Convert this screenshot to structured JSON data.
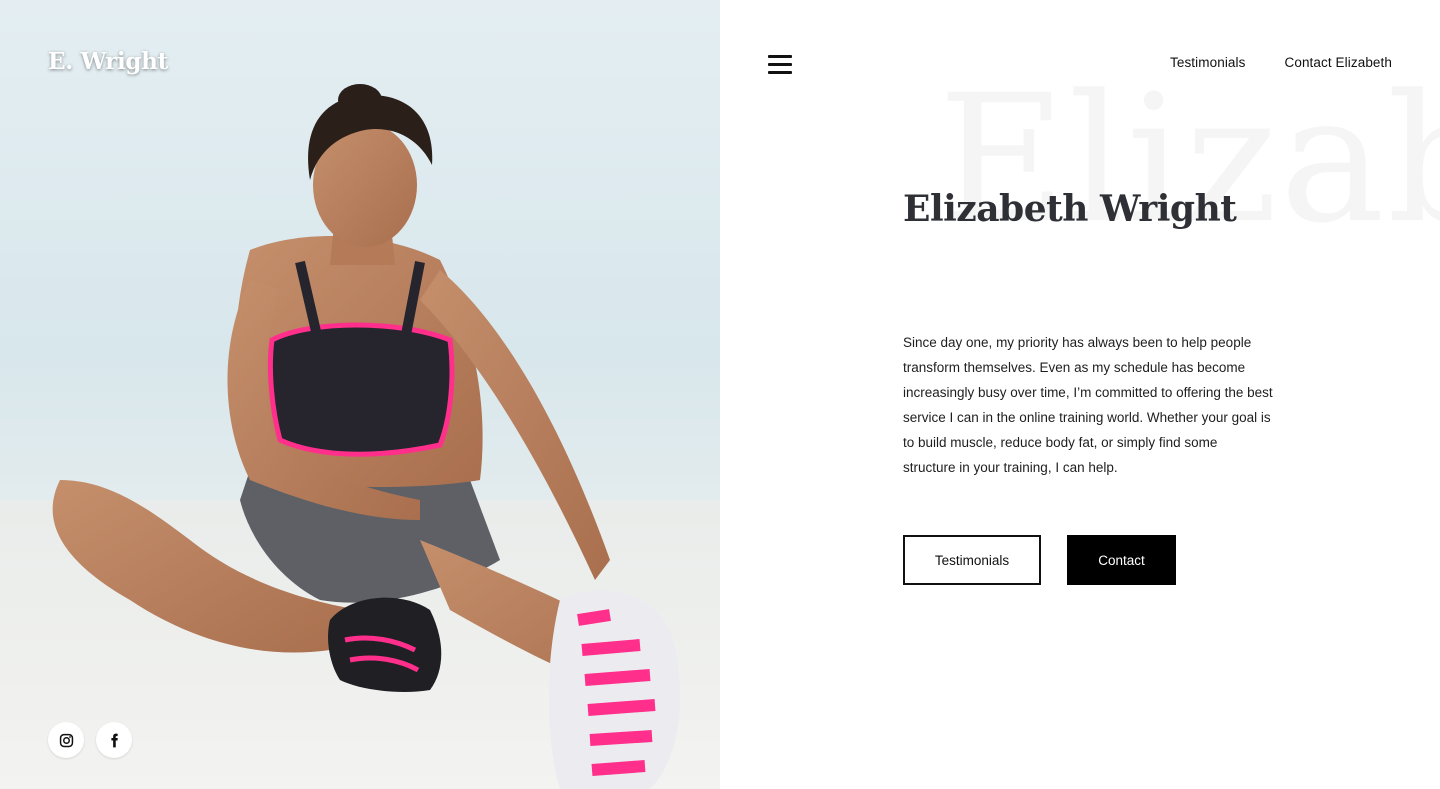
{
  "brand": {
    "logo_text": "E. Wright"
  },
  "hero": {
    "photo": "athlete-stretching-photo"
  },
  "social": {
    "items": [
      {
        "icon": "instagram-icon",
        "label": "Instagram"
      },
      {
        "icon": "facebook-icon",
        "label": "Facebook"
      }
    ]
  },
  "nav": {
    "menu_icon": "hamburger-menu-icon",
    "links": [
      "Testimonials",
      "Contact Elizabeth"
    ]
  },
  "main": {
    "background_word": "Elizabeth",
    "title": "Elizabeth Wright",
    "bio": "Since day one, my priority has always been to help people transform themselves. Even as my schedule has become increasingly busy over time, I’m committed to offering the best service I can in the online training world. Whether your goal is to build muscle, reduce body fat, or simply find some structure in your training, I can help.",
    "buttons": {
      "primary_outline": "Testimonials",
      "primary_solid": "Contact"
    }
  },
  "colors": {
    "text": "#1e1e1e",
    "heading": "#2f3036",
    "accent_pink": "#ff2f8b",
    "button_dark": "#000000"
  }
}
